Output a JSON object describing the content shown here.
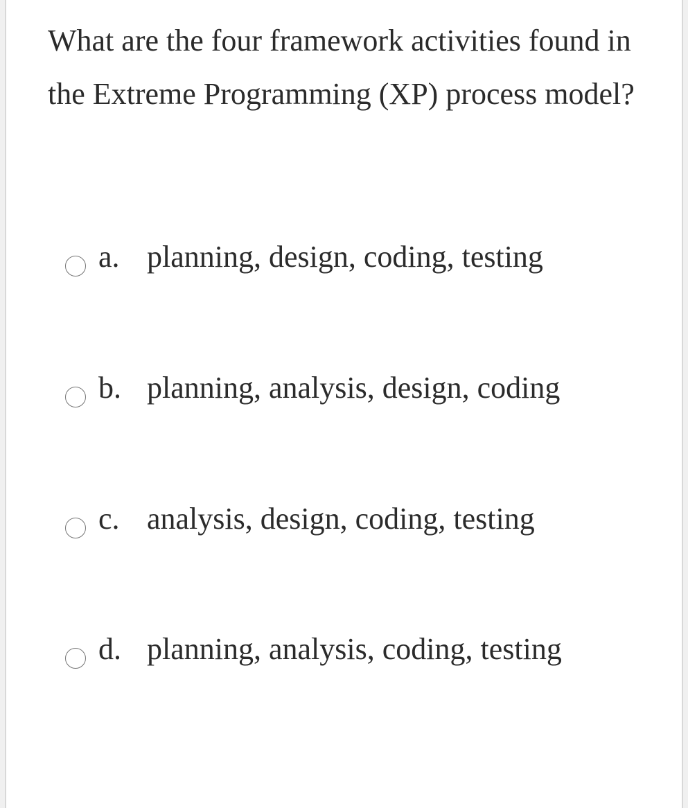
{
  "question": "What are the four framework activities found in the Extreme Programming (XP) process model?",
  "options": [
    {
      "letter": "a.",
      "text": "planning, design, coding, testing"
    },
    {
      "letter": "b.",
      "text": "planning, analysis, design, coding"
    },
    {
      "letter": "c.",
      "text": " analysis, design, coding, testing"
    },
    {
      "letter": "d.",
      "text": "planning, analysis, coding, testing"
    }
  ]
}
